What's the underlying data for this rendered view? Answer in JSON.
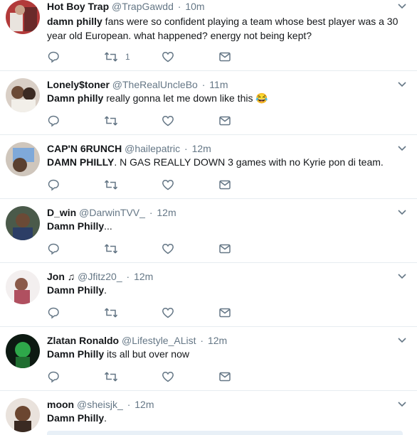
{
  "tweets": [
    {
      "name": "Hot Boy Trap",
      "handle": "@TrapGawdd",
      "time": "10m",
      "bold": "damn philly",
      "rest": " fans were so confident playing a team whose best player was a 30 year old European. what happened? energy not being kept?",
      "retweets": "1"
    },
    {
      "name": "Lonely$toner",
      "handle": "@TheRealUncleBo",
      "time": "11m",
      "bold": "Damn philly",
      "rest": " really gonna let me down like this 😂",
      "retweets": ""
    },
    {
      "name": "CAP'N 6RUNCH",
      "handle": "@hailepatric",
      "time": "12m",
      "bold": "DAMN PHILLY",
      "rest": ". N  GAS REALLY DOWN 3 games with no Kyrie pon di team.",
      "retweets": ""
    },
    {
      "name": "D_win",
      "handle": "@DarwinTVV_",
      "time": "12m",
      "bold": "Damn Philly",
      "rest": "...",
      "retweets": ""
    },
    {
      "name": "Jon ♫",
      "handle": "@Jfitz20_",
      "time": "12m",
      "bold": "Damn Philly",
      "rest": ".",
      "retweets": ""
    },
    {
      "name": "Zlatan Ronaldo",
      "handle": "@Lifestyle_AList",
      "time": "12m",
      "bold": "Damn Philly",
      "rest": " its all but over now",
      "retweets": ""
    },
    {
      "name": "moon",
      "handle": "@sheisjk_",
      "time": "12m",
      "bold": "Damn Philly",
      "rest": ".",
      "retweets": ""
    }
  ],
  "separator": "·",
  "colors": {
    "text": "#14171a",
    "muted": "#657786",
    "border": "#e6ecf0"
  },
  "icons": {
    "reply": "reply-icon",
    "retweet": "retweet-icon",
    "like": "heart-icon",
    "dm": "envelope-icon",
    "caret": "chevron-down-icon"
  }
}
